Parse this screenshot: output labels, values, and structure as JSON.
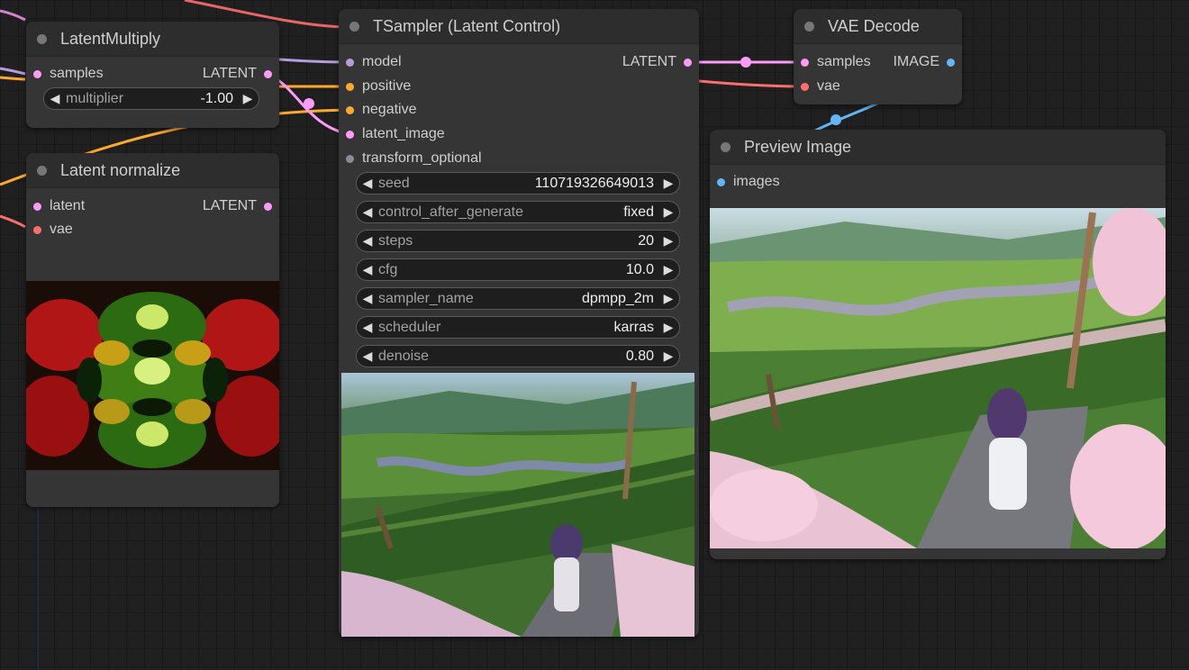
{
  "nodes": {
    "latent_multiply": {
      "title": "LatentMultiply",
      "input_samples": "samples",
      "output_latent": "LATENT",
      "multiplier": {
        "label": "multiplier",
        "value": "-1.00"
      }
    },
    "latent_normalize": {
      "title": "Latent normalize",
      "input_latent": "latent",
      "input_vae": "vae",
      "output_latent": "LATENT"
    },
    "tsampler": {
      "title": "TSampler (Latent Control)",
      "inputs": [
        "model",
        "positive",
        "negative",
        "latent_image",
        "transform_optional"
      ],
      "output_latent": "LATENT",
      "widgets": [
        {
          "label": "seed",
          "value": "110719326649013"
        },
        {
          "label": "control_after_generate",
          "value": "fixed"
        },
        {
          "label": "steps",
          "value": "20"
        },
        {
          "label": "cfg",
          "value": "10.0"
        },
        {
          "label": "sampler_name",
          "value": "dpmpp_2m"
        },
        {
          "label": "scheduler",
          "value": "karras"
        },
        {
          "label": "denoise",
          "value": "0.80"
        }
      ]
    },
    "vae_decode": {
      "title": "VAE Decode",
      "input_samples": "samples",
      "input_vae": "vae",
      "output_image": "IMAGE"
    },
    "preview_image": {
      "title": "Preview Image",
      "input_images": "images"
    }
  },
  "colors": {
    "model": "#b39ddb",
    "conditioning": "#ffa931",
    "latent": "#ff9cf9",
    "vae": "#ff6e6e",
    "image": "#64b5f6",
    "transform": "#8a8a9a"
  }
}
